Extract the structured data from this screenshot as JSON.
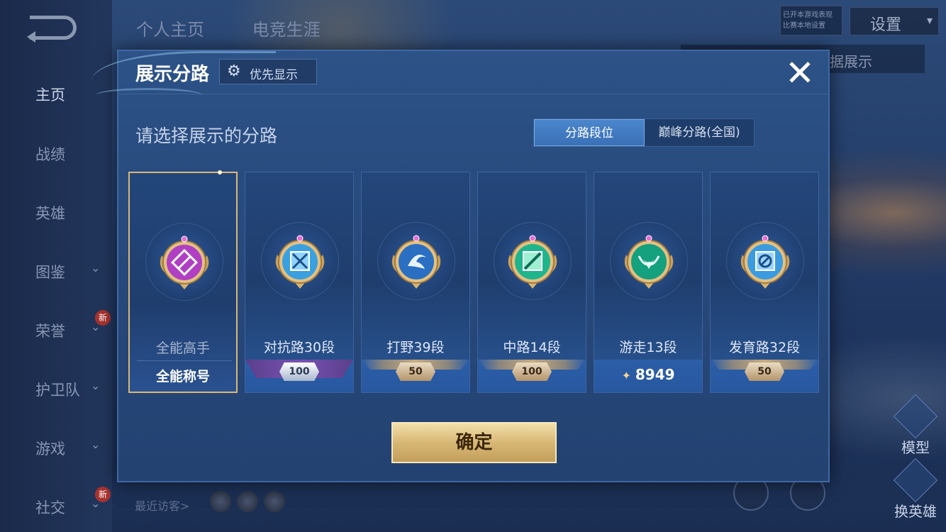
{
  "background": {
    "back_icon": "back-arrow-icon",
    "top_tabs": [
      "个人主页",
      "电竞生涯"
    ],
    "settings_label": "设置",
    "mini_info": [
      "已开本游戏表现",
      "比赛本地设置"
    ],
    "data_banner": "定和数据展示",
    "sidebar": [
      {
        "label": "主页",
        "chevron": false,
        "active": true,
        "new": false
      },
      {
        "label": "战绩",
        "chevron": false,
        "active": false,
        "new": false
      },
      {
        "label": "英雄",
        "chevron": false,
        "active": false,
        "new": false
      },
      {
        "label": "图鉴",
        "chevron": true,
        "active": false,
        "new": false
      },
      {
        "label": "荣誉",
        "chevron": true,
        "active": false,
        "new": true
      },
      {
        "label": "护卫队",
        "chevron": true,
        "active": false,
        "new": false
      },
      {
        "label": "游戏",
        "chevron": true,
        "active": false,
        "new": false
      },
      {
        "label": "社交",
        "chevron": true,
        "active": false,
        "new": true
      }
    ],
    "new_badge": "新",
    "recent_visitors": "最近访客>",
    "right_buttons": [
      "模型",
      "换英雄"
    ]
  },
  "modal": {
    "title": "展示分路",
    "priority_label": "优先显示",
    "close_icon": "close-x-icon",
    "subtitle": "请选择展示的分路",
    "segments": [
      {
        "label": "分路段位",
        "active": true
      },
      {
        "label": "巅峰分路(全国)",
        "active": false
      }
    ],
    "cards": [
      {
        "name": "全能高手",
        "footer_type": "text",
        "footer": "全能称号",
        "selected": true,
        "emblem": "purple-allround-emblem-icon",
        "emblem_color": "#b03fc4"
      },
      {
        "name": "对抗路30段",
        "footer_type": "rank",
        "footer": "100",
        "badge_style": "silver-purple",
        "selected": false,
        "emblem": "clash-lane-emblem-icon",
        "emblem_color": "#3aa0e0"
      },
      {
        "name": "打野39段",
        "footer_type": "rank",
        "footer": "50",
        "badge_style": "gold",
        "selected": false,
        "emblem": "jungle-dragon-emblem-icon",
        "emblem_color": "#2a6fc2"
      },
      {
        "name": "中路14段",
        "footer_type": "rank",
        "footer": "100",
        "badge_style": "gold",
        "selected": false,
        "emblem": "mid-lane-emblem-icon",
        "emblem_color": "#1fb58c"
      },
      {
        "name": "游走13段",
        "footer_type": "points",
        "footer": "8949",
        "selected": false,
        "emblem": "roam-wings-emblem-icon",
        "emblem_color": "#15a07e"
      },
      {
        "name": "发育路32段",
        "footer_type": "rank",
        "footer": "50",
        "badge_style": "gold",
        "selected": false,
        "emblem": "farm-lane-emblem-icon",
        "emblem_color": "#3b9be0"
      }
    ],
    "confirm_label": "确定"
  },
  "colors": {
    "modal_bg": "#2a4e82",
    "accent_blue": "#4b86cc",
    "gold": "#d8b876",
    "selected_border": "#d9b877"
  }
}
